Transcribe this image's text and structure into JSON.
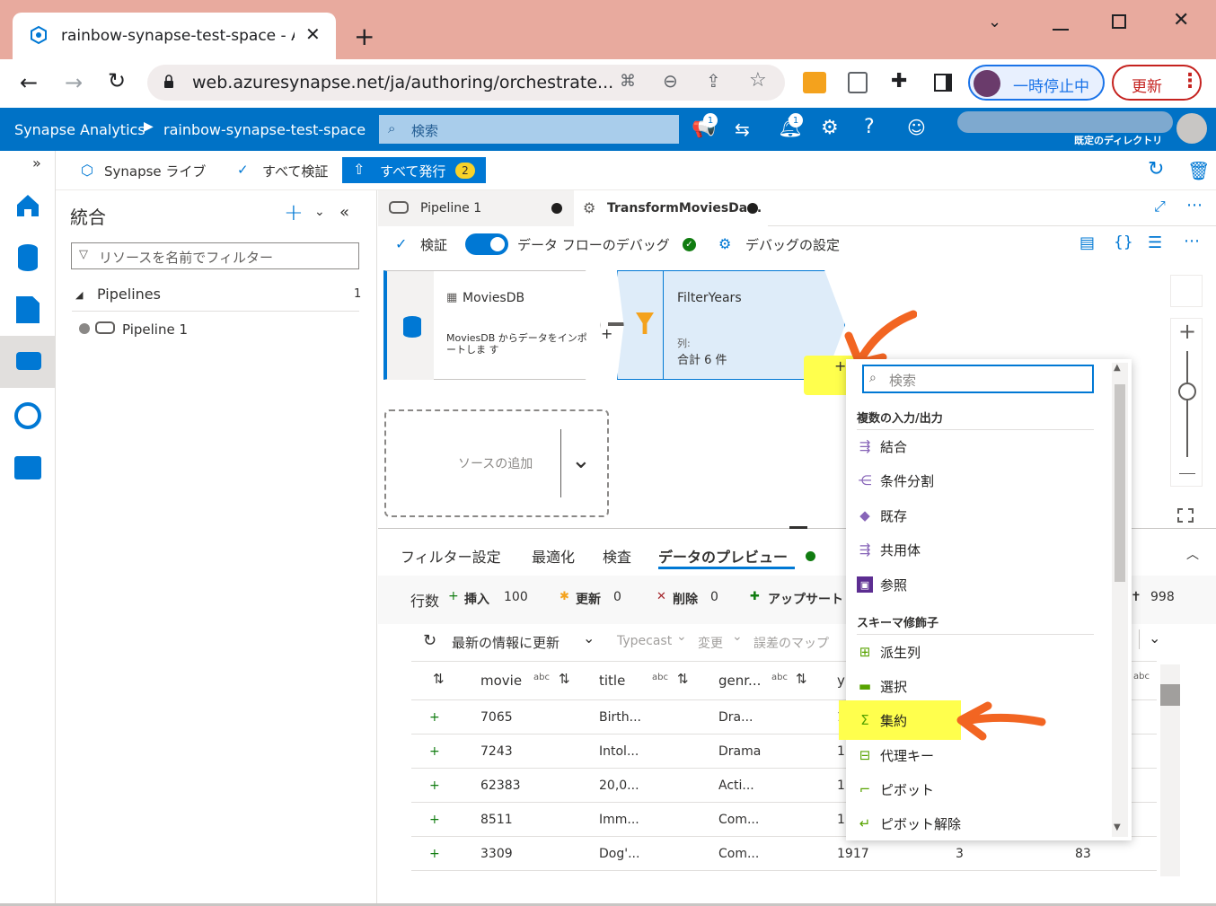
{
  "browser": {
    "tab_title": "rainbow-synapse-test-space - Az",
    "url": "web.azuresynapse.net/ja/authoring/orchestrate...",
    "profile_label": "一時停止中",
    "update_label": "更新"
  },
  "header": {
    "product": "Synapse Analytics",
    "workspace": "rainbow-synapse-test-space",
    "search_placeholder": "検索",
    "notif_badge_1": "1",
    "notif_badge_2": "1",
    "directory": "既定のディレクトリ"
  },
  "subtoolbar": {
    "live": "Synapse ライブ",
    "validate_all": "すべて検証",
    "publish_all": "すべて発行",
    "publish_count": "2"
  },
  "left_panel": {
    "title": "統合",
    "filter_placeholder": "リソースを名前でフィルター",
    "section": "Pipelines",
    "section_count": "1",
    "item": "Pipeline 1"
  },
  "doc_tabs": [
    {
      "label": "Pipeline 1"
    },
    {
      "label": "TransformMoviesDa..."
    }
  ],
  "flow_toolbar": {
    "validate": "検証",
    "debug": "データ フローのデバッグ",
    "debug_settings": "デバッグの設定"
  },
  "canvas": {
    "source_title": "MoviesDB",
    "source_desc": "MoviesDB からデータをインポートしま す",
    "filter_title": "FilterYears",
    "filter_cols_label": "列:",
    "filter_cols_value": "合計 6 件",
    "add_source": "ソースの追加"
  },
  "bottom_tabs": [
    "フィルター設定",
    "最適化",
    "検査",
    "データのプレビュー"
  ],
  "stats": {
    "rows_label": "行数",
    "insert_label": "挿入",
    "insert_value": "100",
    "update_label": "更新",
    "update_value": "0",
    "delete_label": "削除",
    "delete_value": "0",
    "upsert_label": "アップサート",
    "right_value": "998"
  },
  "preview_toolbar": {
    "refresh": "最新の情報に更新",
    "typecast": "Typecast",
    "modify": "変更",
    "error_map": "誤差のマップ"
  },
  "table": {
    "headers": [
      "movie",
      "title",
      "genr..."
    ],
    "type_abc": "abc",
    "rows": [
      {
        "movie": "7065",
        "title": "Birth...",
        "genre": "Dra...",
        "y": "1!",
        "c5": "",
        "c6": ""
      },
      {
        "movie": "7243",
        "title": "Intol...",
        "genre": "Drama",
        "y": "1!",
        "c5": "",
        "c6": ""
      },
      {
        "movie": "62383",
        "title": "20,0...",
        "genre": "Acti...",
        "y": "1!",
        "c5": "",
        "c6": ""
      },
      {
        "movie": "8511",
        "title": "Imm...",
        "genre": "Com...",
        "y": "1!",
        "c5": "",
        "c6": ""
      },
      {
        "movie": "3309",
        "title": "Dog'...",
        "genre": "Com...",
        "y": "1917",
        "c5": "3",
        "c6": "83"
      }
    ]
  },
  "dropdown": {
    "search_placeholder": "検索",
    "group1": "複数の入力/出力",
    "group1_items": [
      "結合",
      "条件分割",
      "既存",
      "共用体",
      "参照"
    ],
    "group2": "スキーマ修飾子",
    "group2_items": [
      "派生列",
      "選択",
      "集約",
      "代理キー",
      "ピボット",
      "ピボット解除"
    ]
  },
  "colors": {
    "azure_blue": "#0072c6",
    "accent": "#0078d4",
    "highlight": "#ffff4d",
    "annotation_arrow": "#f26522"
  }
}
